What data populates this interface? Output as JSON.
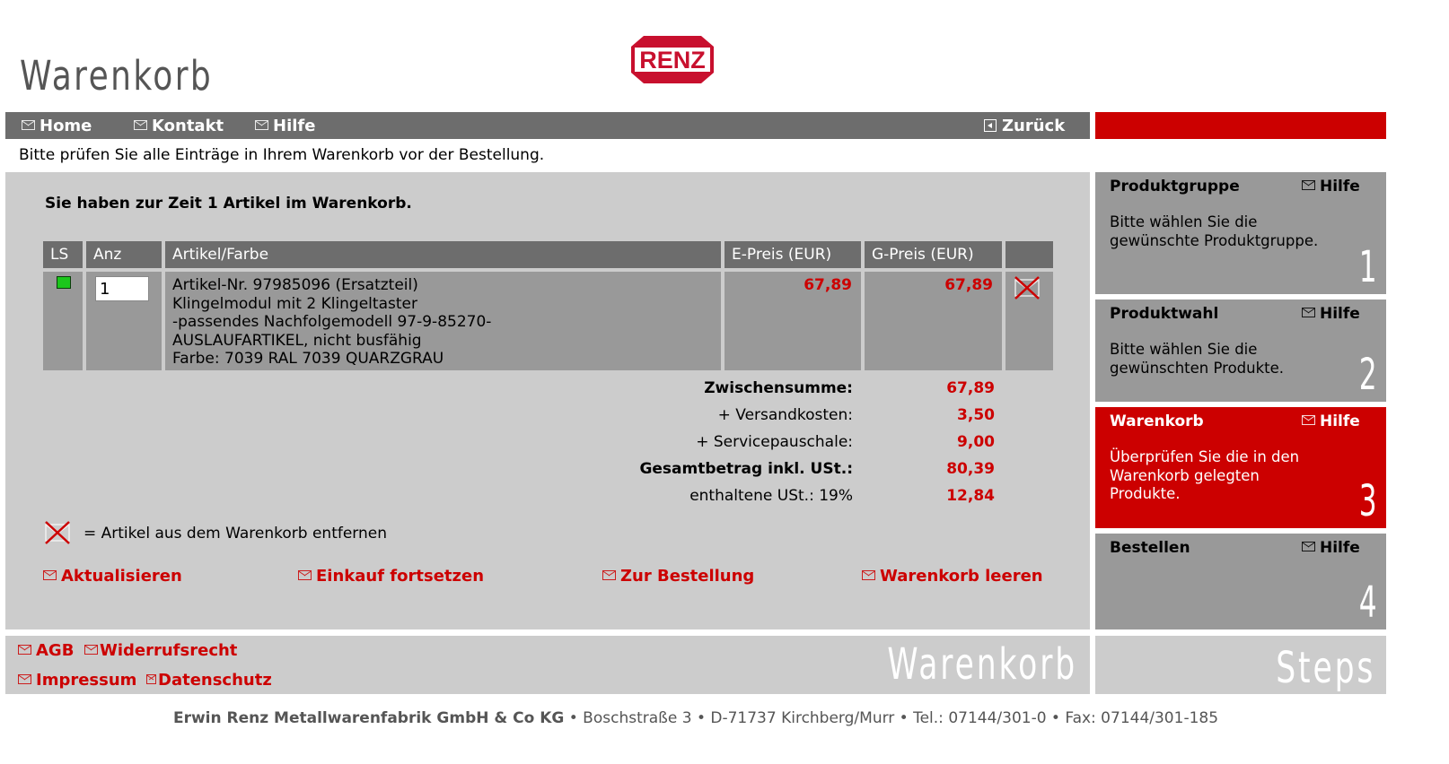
{
  "header": {
    "title": "Warenkorb",
    "logo_text": "RENZ"
  },
  "colors": {
    "accent_red": "#cc0000",
    "nav_gray": "#6d6d6d",
    "panel_gray": "#cccccc",
    "cell_gray": "#999999",
    "status_green": "#1cc61c"
  },
  "nav": {
    "home": "Home",
    "contact": "Kontakt",
    "help": "Hilfe",
    "back": "Zurück"
  },
  "intro": "Bitte prüfen Sie alle Einträge in Ihrem Warenkorb vor der Bestellung.",
  "cart": {
    "count_text": "Sie haben zur Zeit 1 Artikel im Warenkorb.",
    "columns": {
      "ls": "LS",
      "qty": "Anz",
      "article": "Artikel/Farbe",
      "unit_price": "E-Preis (EUR)",
      "total_price": "G-Preis (EUR)"
    },
    "items": [
      {
        "qty": "1",
        "lines": [
          "Artikel-Nr. 97985096 (Ersatzteil)",
          "Klingelmodul mit 2 Klingeltaster",
          "-passendes Nachfolgemodell 97-9-85270-",
          "AUSLAUFARTIKEL, nicht busfähig",
          "Farbe: 7039 RAL 7039 QUARZGRAU"
        ],
        "unit_price": "67,89",
        "total_price": "67,89"
      }
    ],
    "summary": [
      {
        "label": "Zwischensumme:",
        "value": "67,89",
        "bold": true
      },
      {
        "label": "+ Versandkosten:",
        "value": "3,50",
        "bold": false
      },
      {
        "label": "+ Servicepauschale:",
        "value": "9,00",
        "bold": false
      },
      {
        "label": "Gesamtbetrag inkl. USt.:",
        "value": "80,39",
        "bold": true
      },
      {
        "label": "enthaltene USt.: 19%",
        "value": "12,84",
        "bold": false
      }
    ],
    "legend": "= Artikel aus dem Warenkorb entfernen",
    "actions": {
      "update": "Aktualisieren",
      "continue": "Einkauf fortsetzen",
      "checkout": "Zur Bestellung",
      "clear": "Warenkorb leeren"
    }
  },
  "steps": [
    {
      "title": "Produktgruppe",
      "help": "Hilfe",
      "desc": "Bitte wählen Sie die gewünschte Produktgruppe.",
      "num": "1"
    },
    {
      "title": "Produktwahl",
      "help": "Hilfe",
      "desc": "Bitte wählen Sie die gewünschten Produkte.",
      "num": "2"
    },
    {
      "title": "Warenkorb",
      "help": "Hilfe",
      "desc": "Überprüfen Sie die in den Warenkorb gelegten Produkte.",
      "num": "3"
    },
    {
      "title": "Bestellen",
      "help": "Hilfe",
      "desc": "",
      "num": "4"
    }
  ],
  "footer": {
    "agb": "AGB",
    "withdrawal": "Widerrufsrecht",
    "imprint": "Impressum",
    "privacy": "Datenschutz",
    "watermark_left": "Warenkorb",
    "watermark_right": "Steps",
    "company_name": "Erwin Renz Metallwarenfabrik GmbH & Co KG",
    "company_details": " • Boschstraße 3 • D-71737 Kirchberg/Murr • Tel.: 07144/301-0 • Fax: 07144/301-185"
  }
}
